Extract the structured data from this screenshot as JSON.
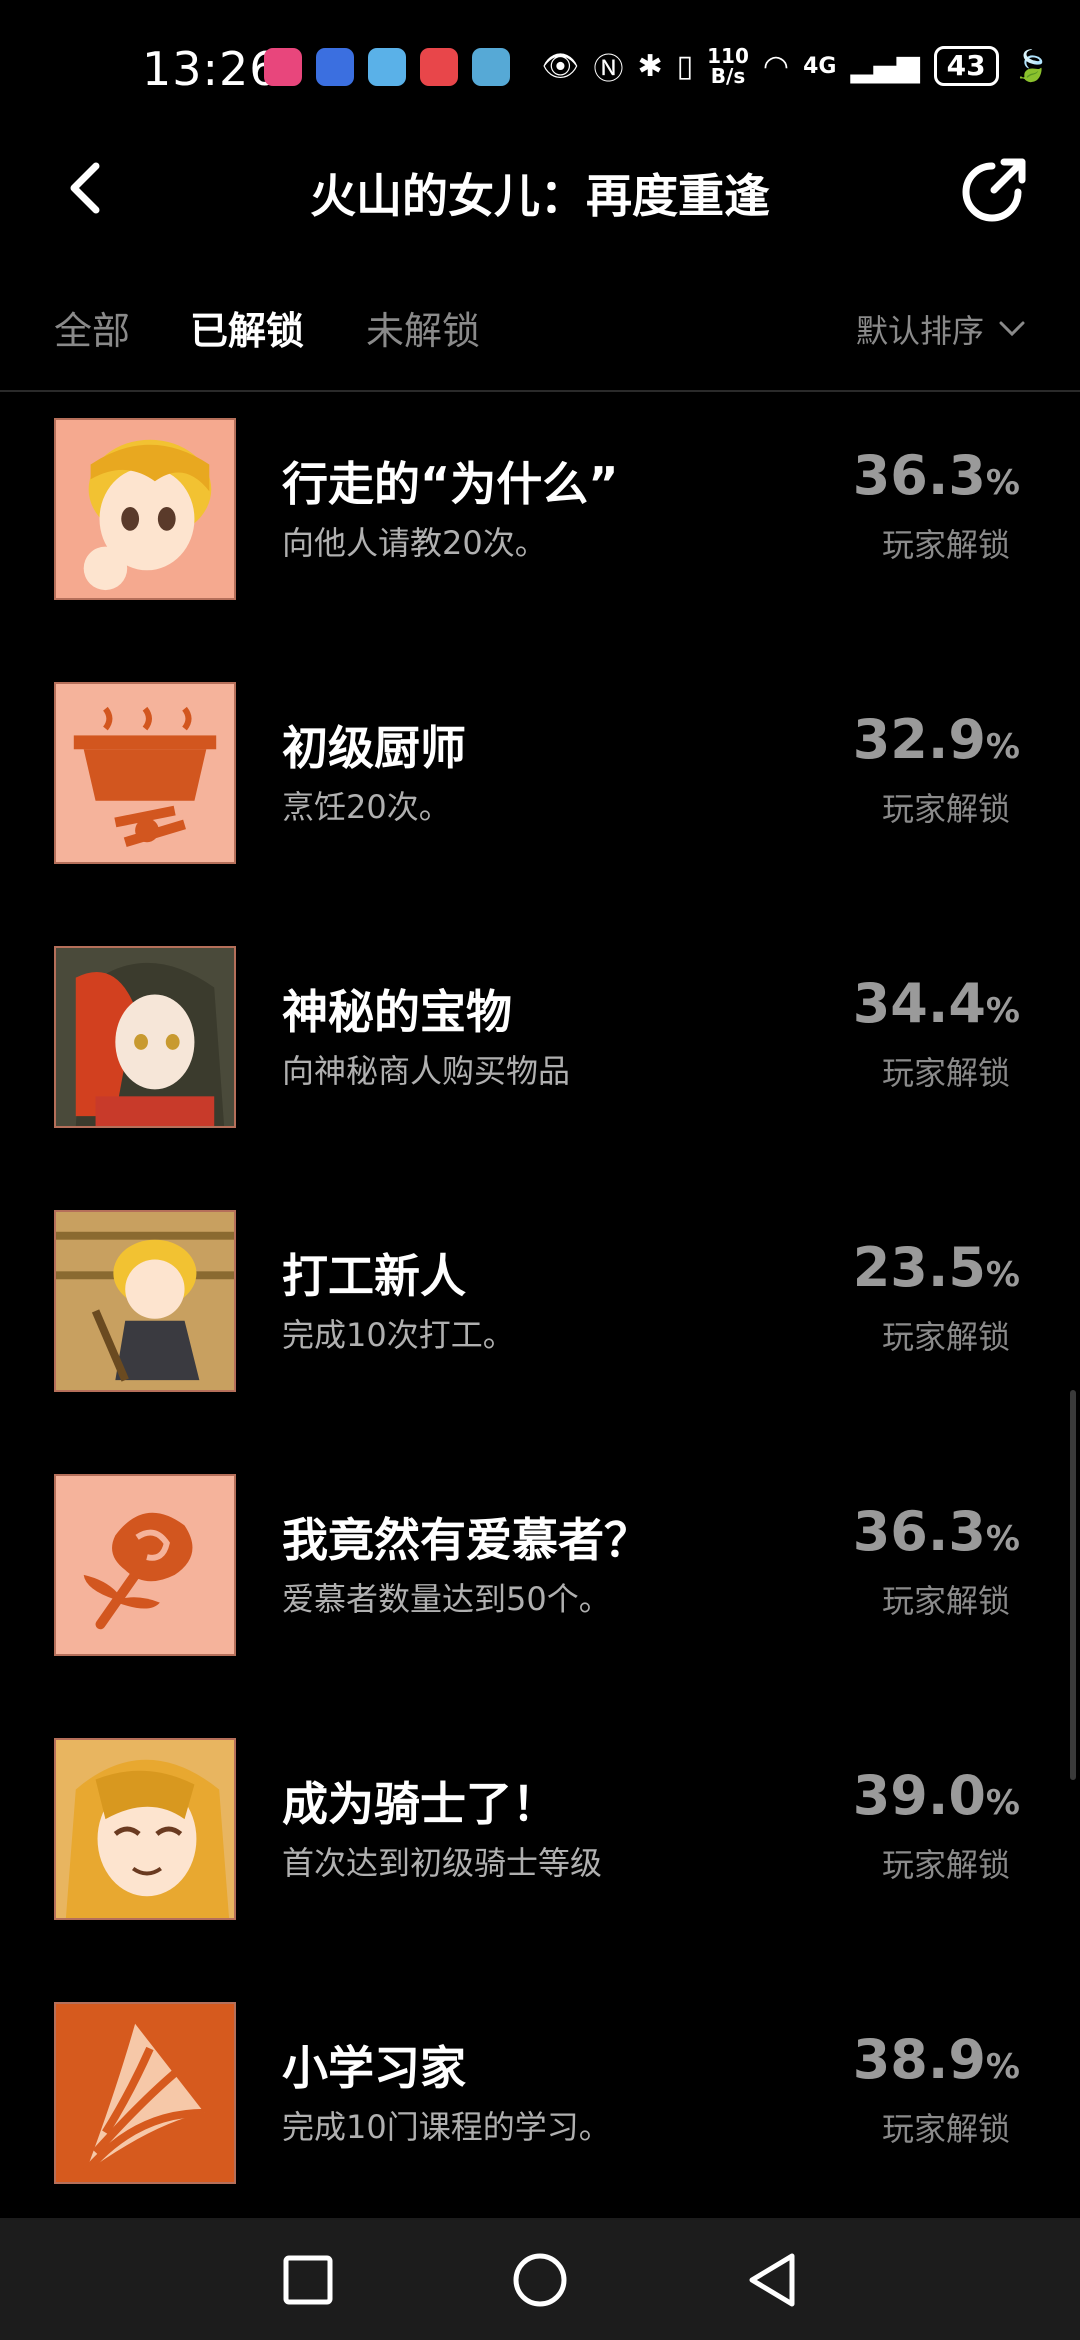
{
  "status": {
    "time": "13:26",
    "net_speed_top": "110",
    "net_speed_bottom": "B/s",
    "network": "4G",
    "battery": "43",
    "app_icon_colors": [
      "#e8467c",
      "#3b6fe0",
      "#5ab1e8",
      "#e8464a",
      "#56a9d6"
    ]
  },
  "header": {
    "title": "火山的女儿：再度重逢"
  },
  "tabs": {
    "all": "全部",
    "unlocked": "已解锁",
    "locked": "未解锁",
    "sort": "默认排序"
  },
  "achievements": [
    {
      "name": "行走的“为什么”",
      "desc": "向他人请教20次。",
      "pct": "36.3",
      "unit": "%",
      "sub": "玩家解锁",
      "icon": "curious-girl-icon"
    },
    {
      "name": "初级厨师",
      "desc": "烹饪20次。",
      "pct": "32.9",
      "unit": "%",
      "sub": "玩家解锁",
      "icon": "cooking-pot-icon"
    },
    {
      "name": "神秘的宝物",
      "desc": "向神秘商人购买物品",
      "pct": "34.4",
      "unit": "%",
      "sub": "玩家解锁",
      "icon": "hooded-merchant-icon"
    },
    {
      "name": "打工新人",
      "desc": "完成10次打工。",
      "pct": "23.5",
      "unit": "%",
      "sub": "玩家解锁",
      "icon": "maid-sweeping-icon"
    },
    {
      "name": "我竟然有爱慕者？",
      "desc": "爱慕者数量达到50个。",
      "pct": "36.3",
      "unit": "%",
      "sub": "玩家解锁",
      "icon": "rose-icon"
    },
    {
      "name": "成为骑士了！",
      "desc": "首次达到初级骑士等级",
      "pct": "39.0",
      "unit": "%",
      "sub": "玩家解锁",
      "icon": "smiling-knight-icon"
    },
    {
      "name": "小学习家",
      "desc": "完成10门课程的学习。",
      "pct": "38.9",
      "unit": "%",
      "sub": "玩家解锁",
      "icon": "book-pages-icon"
    }
  ]
}
